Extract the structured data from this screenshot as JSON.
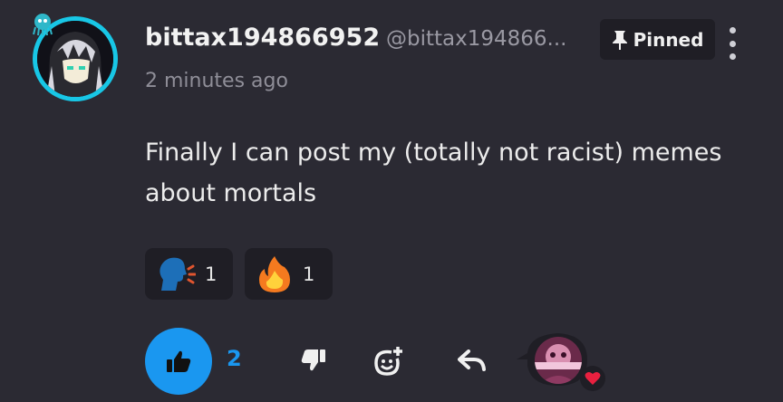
{
  "post": {
    "username": "bittax194866952",
    "handle": "@bittax194866...",
    "timestamp": "2 minutes ago",
    "pinned_label": "Pinned",
    "text": "Finally I can post my (totally not racist) memes about mortals"
  },
  "reactions": [
    {
      "emoji": "speaking-head-icon",
      "count": "1"
    },
    {
      "emoji": "fire-icon",
      "count": "1"
    }
  ],
  "actions": {
    "like_count": "2"
  },
  "colors": {
    "background": "#2b2a33",
    "accent": "#1a97f0",
    "avatar_ring": "#18c7e6",
    "heart": "#e8203f"
  }
}
